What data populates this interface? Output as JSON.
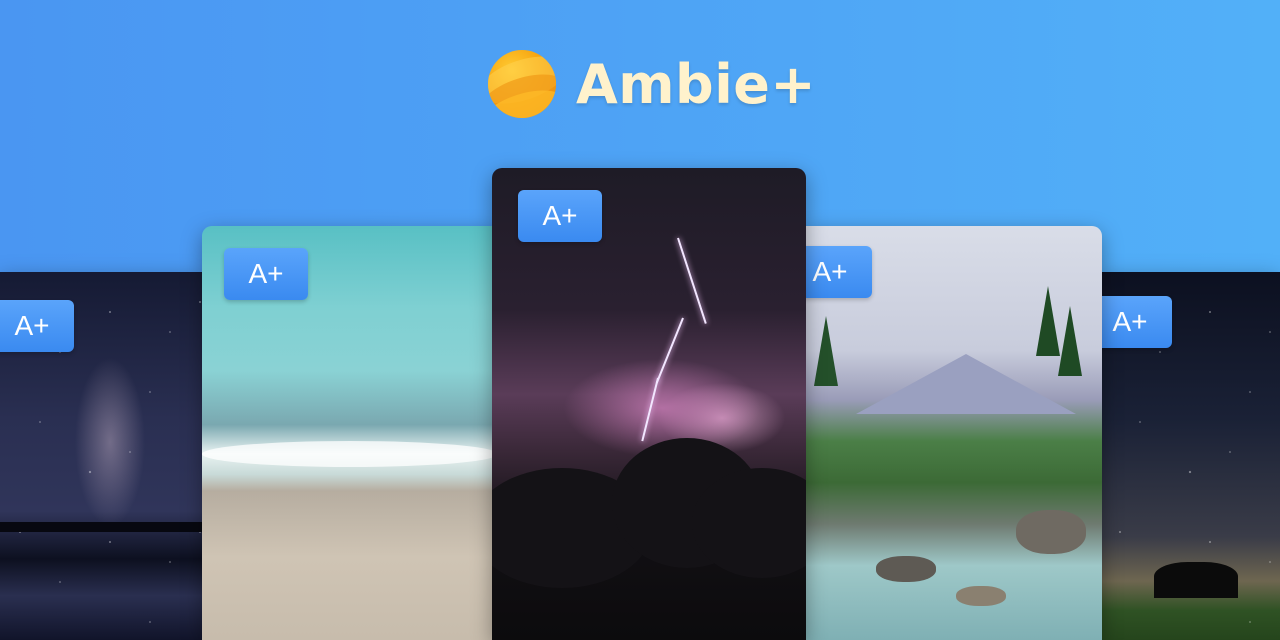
{
  "app": {
    "title": "Ambie+"
  },
  "icons": {
    "logo": "ambie-logo-icon"
  },
  "colors": {
    "background_start": "#4a96f2",
    "background_end": "#52b0f8",
    "title_color": "#fff2cc",
    "badge_color": "#4a9af7"
  },
  "cards": [
    {
      "id": "night-lake",
      "badge": "A+"
    },
    {
      "id": "beach",
      "badge": "A+"
    },
    {
      "id": "storm",
      "badge": "A+"
    },
    {
      "id": "river",
      "badge": "A+"
    },
    {
      "id": "night-trees",
      "badge": "A+"
    }
  ]
}
